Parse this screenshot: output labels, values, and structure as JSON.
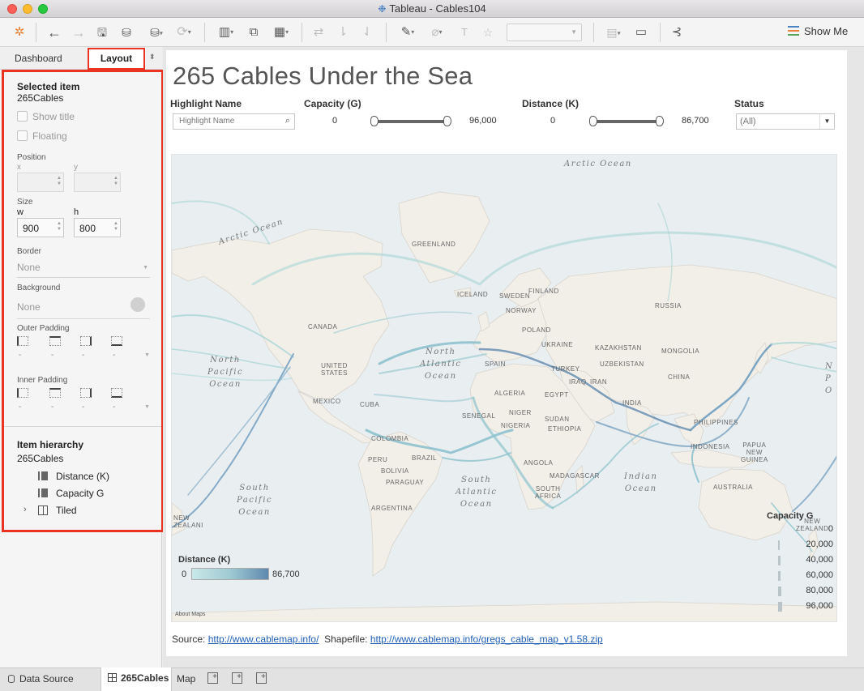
{
  "window": {
    "title": "Tableau - Cables104"
  },
  "toolbar": {
    "show_me": "Show Me"
  },
  "left_pane": {
    "tabs": {
      "dashboard": "Dashboard",
      "layout": "Layout"
    },
    "selected_item": {
      "heading": "Selected item",
      "name": "265Cables",
      "show_title": "Show title",
      "floating": "Floating"
    },
    "position": {
      "label": "Position",
      "x_label": "x",
      "y_label": "y",
      "x_value": "",
      "y_value": ""
    },
    "size": {
      "label": "Size",
      "w_label": "w",
      "h_label": "h",
      "w_value": "900",
      "h_value": "800"
    },
    "border": {
      "label": "Border",
      "value": "None"
    },
    "background": {
      "label": "Background",
      "value": "None"
    },
    "outer_padding": {
      "label": "Outer Padding",
      "values": [
        "-",
        "-",
        "-",
        "-"
      ]
    },
    "inner_padding": {
      "label": "Inner Padding",
      "values": [
        "-",
        "-",
        "-",
        "-"
      ]
    },
    "hierarchy": {
      "heading": "Item hierarchy",
      "root": "265Cables",
      "items": [
        "Distance (K)",
        "Capacity G",
        "Tiled"
      ]
    }
  },
  "dashboard": {
    "title": "265 Cables Under the Sea",
    "filters": {
      "highlight": {
        "label": "Highlight Name",
        "placeholder": "Highlight Name"
      },
      "capacity": {
        "label": "Capacity (G)",
        "min": "0",
        "max": "96,000",
        "low_fraction": 0,
        "high_fraction": 1
      },
      "distance": {
        "label": "Distance (K)",
        "min": "0",
        "max": "86,700",
        "low_fraction": 0,
        "high_fraction": 1
      },
      "status": {
        "label": "Status",
        "value": "(All)"
      }
    },
    "map": {
      "oceans": {
        "arctic_top": "Arctic Ocean",
        "arctic_left": "Arctic Ocean",
        "north_pacific": [
          "North",
          "Pacific",
          "Ocean"
        ],
        "north_atlantic": [
          "North",
          "Atlantic",
          "Ocean"
        ],
        "south_pacific": [
          "South",
          "Pacific",
          "Ocean"
        ],
        "south_atlantic": [
          "South",
          "Atlantic",
          "Ocean"
        ],
        "indian": [
          "Indian",
          "Ocean"
        ],
        "pacific_right": [
          "N",
          "P",
          "O"
        ]
      },
      "countries": {
        "greenland": "GREENLAND",
        "iceland": "ICELAND",
        "canada": "CANADA",
        "united_states": [
          "UNITED",
          "STATES"
        ],
        "mexico": "MEXICO",
        "cuba": "CUBA",
        "colombia": "COLOMBIA",
        "peru": "PERU",
        "brazil": "BRAZIL",
        "bolivia": "BOLIVIA",
        "paraguay": "PARAGUAY",
        "argentina": "ARGENTINA",
        "sweden": "SWEDEN",
        "finland": "FINLAND",
        "norway": "NORWAY",
        "poland": "POLAND",
        "ukraine": "UKRAINE",
        "spain": "SPAIN",
        "turkey": "TURKEY",
        "russia": "RUSSIA",
        "kazakhstan": "KAZAKHSTAN",
        "mongolia": "MONGOLIA",
        "uzbekistan": "UZBEKISTAN",
        "china": "CHINA",
        "iraq": "IRAQ",
        "iran": "IRAN",
        "india": "INDIA",
        "algeria": "ALGERIA",
        "egypt": "EGYPT",
        "niger": "NIGER",
        "nigeria": "NIGERIA",
        "senegal": "SENEGAL",
        "sudan": "SUDAN",
        "ethiopia": "ETHIOPIA",
        "angola": "ANGOLA",
        "madagascar": "MADAGASCAR",
        "south_africa": [
          "SOUTH",
          "AFRICA"
        ],
        "philippines": "PHILIPPINES",
        "indonesia": "INDONESIA",
        "papua": [
          "PAPUA",
          "NEW",
          "GUINEA"
        ],
        "australia": "AUSTRALIA",
        "new_zealand": [
          "NEW",
          "ZEALAND"
        ],
        "new_zealand_left": [
          "NEW",
          "ZEALANI"
        ]
      },
      "about": "About Maps"
    },
    "legend_distance": {
      "title": "Distance (K)",
      "min": "0",
      "max": "86,700"
    },
    "legend_capacity": {
      "title": "Capacity G",
      "values": [
        "0",
        "20,000",
        "40,000",
        "60,000",
        "80,000",
        "96,000"
      ]
    },
    "source": {
      "prefix": "Source:",
      "source_url": "http://www.cablemap.info/",
      "shapefile_prefix": "Shapefile:",
      "shapefile_url": "http://www.cablemap.info/gregs_cable_map_v1.58.zip"
    }
  },
  "bottom_tabs": {
    "data_source": "Data Source",
    "sheet_active": "265Cables",
    "sheet_map": "Map"
  },
  "colors": {
    "accent_highlight": "#ea3323",
    "cable_light": "#a9d6d6",
    "cable_dark": "#5f88ae",
    "land": "#f2efe9",
    "water": "#e9eef1"
  }
}
